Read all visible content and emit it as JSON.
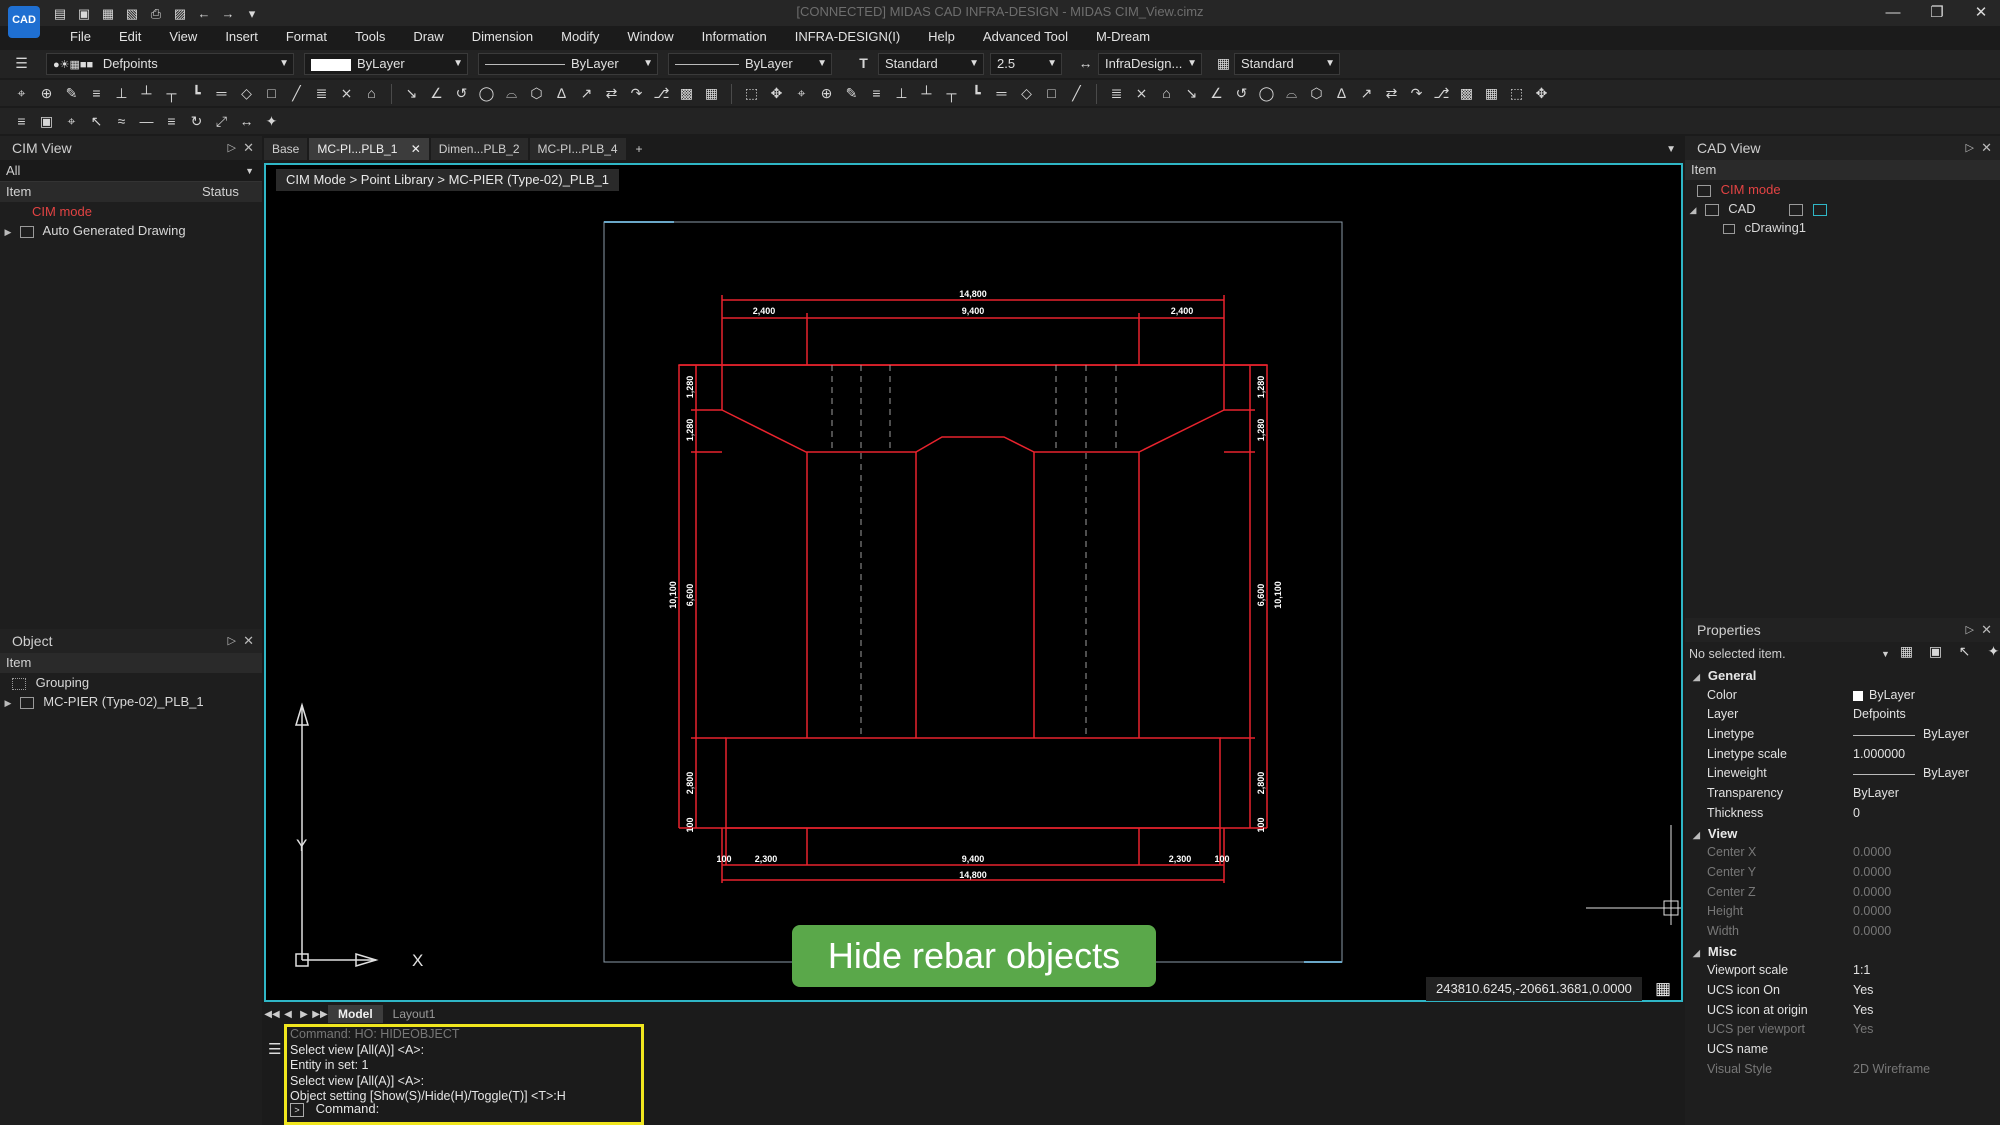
{
  "app": {
    "logo_text": "CAD",
    "window_title": "[CONNECTED] MIDAS CAD INFRA-DESIGN - MIDAS CIM_View.cimz"
  },
  "quick_access": [
    "new-file-icon",
    "open-folder-icon",
    "save-icon",
    "save-as-icon",
    "print-icon",
    "plot-icon",
    "undo-icon",
    "redo-icon",
    "customize-icon"
  ],
  "menu": [
    "File",
    "Edit",
    "View",
    "Insert",
    "Format",
    "Tools",
    "Draw",
    "Dimension",
    "Modify",
    "Window",
    "Information",
    "INFRA-DESIGN(I)",
    "Help",
    "Advanced Tool",
    "M-Dream"
  ],
  "toolbar": {
    "layer_value": "Defpoints",
    "color_value": "ByLayer",
    "linetype_value": "ByLayer",
    "lineweight_value": "ByLayer",
    "textstyle_value": "Standard",
    "textheight_value": "2.5",
    "dimstyle_value": "InfraDesign...",
    "tablestyle_value": "Standard"
  },
  "cim_view": {
    "title": "CIM View",
    "filter": "All",
    "col_item": "Item",
    "col_status": "Status",
    "items": [
      {
        "label": "CIM mode"
      },
      {
        "label": "Auto Generated Drawing"
      }
    ]
  },
  "object_panel": {
    "title": "Object",
    "col_item": "Item",
    "items": [
      {
        "label": "Grouping"
      },
      {
        "label": "MC-PIER (Type-02)_PLB_1"
      }
    ]
  },
  "doc_tabs": [
    {
      "label": "Base",
      "active": false
    },
    {
      "label": "MC-PI...PLB_1",
      "active": true
    },
    {
      "label": "Dimen...PLB_2",
      "active": false
    },
    {
      "label": "MC-PI...PLB_4",
      "active": false
    }
  ],
  "viewport": {
    "breadcrumb": "CIM Mode > Point Library > MC-PIER (Type-02)_PLB_1",
    "hint_banner": "Hide rebar objects",
    "coordinates": "243810.6245,-20661.3681,0.0000",
    "axis_x": "X",
    "axis_y": "Y",
    "dims": {
      "top_total": "14,800",
      "top_left": "2,400",
      "top_mid": "9,400",
      "top_right": "2,400",
      "bot_total": "14,800",
      "bot_left": "2,300",
      "bot_mid": "9,400",
      "bot_right": "2,300",
      "bot_edge_left": "100",
      "bot_edge_right": "100",
      "side_1": "1,280",
      "side_2": "1,280",
      "side_3": "6,600",
      "side_4": "10,100",
      "side_5": "2,800",
      "side_6": "100"
    }
  },
  "model_tabs": [
    {
      "label": "Model",
      "active": true
    },
    {
      "label": "Layout1",
      "active": false
    }
  ],
  "command": {
    "history": [
      "Command: HO: HIDEOBJECT",
      "Select view [All(A)] <A>:",
      "Entity in set: 1",
      "Select view [All(A)] <A>:",
      "Object setting [Show(S)/Hide(H)/Toggle(T)] <T>:H"
    ],
    "prompt": "Command:"
  },
  "cad_view": {
    "title": "CAD View",
    "col_item": "Item",
    "items": [
      {
        "label": "CIM mode"
      },
      {
        "label": "CAD"
      },
      {
        "label": "cDrawing1"
      }
    ]
  },
  "properties": {
    "title": "Properties",
    "selection": "No selected item.",
    "categories": {
      "general": "General",
      "view": "View",
      "misc": "Misc"
    },
    "general": [
      {
        "k": "Color",
        "v": "ByLayer"
      },
      {
        "k": "Layer",
        "v": "Defpoints"
      },
      {
        "k": "Linetype",
        "v": "ByLayer"
      },
      {
        "k": "Linetype scale",
        "v": "1.000000"
      },
      {
        "k": "Lineweight",
        "v": "ByLayer"
      },
      {
        "k": "Transparency",
        "v": "ByLayer"
      },
      {
        "k": "Thickness",
        "v": "0"
      }
    ],
    "view": [
      {
        "k": "Center X",
        "v": "0.0000"
      },
      {
        "k": "Center Y",
        "v": "0.0000"
      },
      {
        "k": "Center Z",
        "v": "0.0000"
      },
      {
        "k": "Height",
        "v": "0.0000"
      },
      {
        "k": "Width",
        "v": "0.0000"
      }
    ],
    "misc": [
      {
        "k": "Viewport scale",
        "v": "1:1"
      },
      {
        "k": "UCS icon On",
        "v": "Yes"
      },
      {
        "k": "UCS icon at origin",
        "v": "Yes"
      },
      {
        "k": "UCS per viewport",
        "v": "Yes"
      },
      {
        "k": "UCS name",
        "v": ""
      },
      {
        "k": "Visual Style",
        "v": "2D Wireframe"
      }
    ]
  },
  "colors": {
    "accent": "#2fb6c6",
    "drawing_red": "#e8232d",
    "banner_green": "#5aa84a",
    "highlight_yellow": "#f0e61e",
    "cim_red": "#e24343"
  }
}
